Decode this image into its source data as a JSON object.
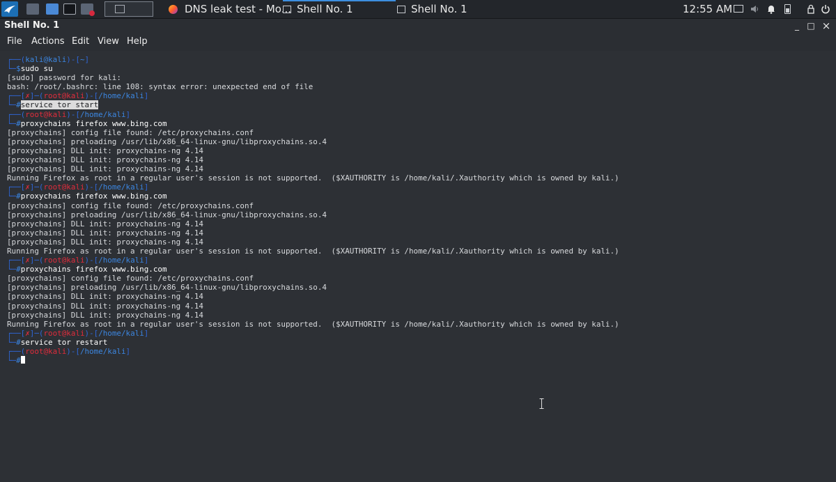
{
  "panel": {
    "clock": "12:55 AM",
    "tasks": [
      {
        "label": "DNS leak test - Mo..."
      },
      {
        "label": "Shell No. 1"
      },
      {
        "label": "Shell No. 1"
      }
    ],
    "accent_color": "#3d8fe0"
  },
  "window": {
    "title": "Shell No. 1",
    "buttons": {
      "minimize": "_",
      "maximize": "□",
      "close": "×"
    }
  },
  "menu": {
    "file": "File",
    "actions": "Actions",
    "edit": "Edit",
    "view": "View",
    "help": "Help"
  },
  "terminal": {
    "colors": {
      "bracket": "#2e67d8",
      "root": "#e12c3c",
      "user": "#3c86e0",
      "text": "#d8dadd"
    },
    "lines": [
      {
        "kind": "prompt-top",
        "user": "kali",
        "host": "kali",
        "dir": "~",
        "err": false,
        "userColor": "usr"
      },
      {
        "kind": "prompt-cmd",
        "sym": "$",
        "cmd": "sudo su",
        "hl": false
      },
      {
        "kind": "out",
        "text": "[sudo] password for kali:"
      },
      {
        "kind": "out",
        "text": "bash: /root/.bashrc: line 108: syntax error: unexpected end of file"
      },
      {
        "kind": "prompt-top",
        "user": "root",
        "host": "kali",
        "dir": "/home/kali",
        "err": true,
        "userColor": "red"
      },
      {
        "kind": "prompt-cmd",
        "sym": "#",
        "cmd": "service tor start",
        "hl": true
      },
      {
        "kind": "prompt-top",
        "user": "root",
        "host": "kali",
        "dir": "/home/kali",
        "err": false,
        "userColor": "red"
      },
      {
        "kind": "prompt-cmd",
        "sym": "#",
        "cmd": "proxychains firefox www.bing.com",
        "hl": false
      },
      {
        "kind": "out",
        "text": "[proxychains] config file found: /etc/proxychains.conf"
      },
      {
        "kind": "out",
        "text": "[proxychains] preloading /usr/lib/x86_64-linux-gnu/libproxychains.so.4"
      },
      {
        "kind": "out",
        "text": "[proxychains] DLL init: proxychains-ng 4.14"
      },
      {
        "kind": "out",
        "text": "[proxychains] DLL init: proxychains-ng 4.14"
      },
      {
        "kind": "out",
        "text": "[proxychains] DLL init: proxychains-ng 4.14"
      },
      {
        "kind": "out",
        "text": "Running Firefox as root in a regular user's session is not supported.  ($XAUTHORITY is /home/kali/.Xauthority which is owned by kali.)"
      },
      {
        "kind": "prompt-top",
        "user": "root",
        "host": "kali",
        "dir": "/home/kali",
        "err": true,
        "userColor": "red"
      },
      {
        "kind": "prompt-cmd",
        "sym": "#",
        "cmd": "proxychains firefox www.bing.com",
        "hl": false
      },
      {
        "kind": "out",
        "text": "[proxychains] config file found: /etc/proxychains.conf"
      },
      {
        "kind": "out",
        "text": "[proxychains] preloading /usr/lib/x86_64-linux-gnu/libproxychains.so.4"
      },
      {
        "kind": "out",
        "text": "[proxychains] DLL init: proxychains-ng 4.14"
      },
      {
        "kind": "out",
        "text": "[proxychains] DLL init: proxychains-ng 4.14"
      },
      {
        "kind": "out",
        "text": "[proxychains] DLL init: proxychains-ng 4.14"
      },
      {
        "kind": "out",
        "text": "Running Firefox as root in a regular user's session is not supported.  ($XAUTHORITY is /home/kali/.Xauthority which is owned by kali.)"
      },
      {
        "kind": "prompt-top",
        "user": "root",
        "host": "kali",
        "dir": "/home/kali",
        "err": true,
        "userColor": "red"
      },
      {
        "kind": "prompt-cmd",
        "sym": "#",
        "cmd": "proxychains firefox www.bing.com",
        "hl": false
      },
      {
        "kind": "out",
        "text": "[proxychains] config file found: /etc/proxychains.conf"
      },
      {
        "kind": "out",
        "text": "[proxychains] preloading /usr/lib/x86_64-linux-gnu/libproxychains.so.4"
      },
      {
        "kind": "out",
        "text": "[proxychains] DLL init: proxychains-ng 4.14"
      },
      {
        "kind": "out",
        "text": "[proxychains] DLL init: proxychains-ng 4.14"
      },
      {
        "kind": "out",
        "text": "[proxychains] DLL init: proxychains-ng 4.14"
      },
      {
        "kind": "out",
        "text": "Running Firefox as root in a regular user's session is not supported.  ($XAUTHORITY is /home/kali/.Xauthority which is owned by kali.)"
      },
      {
        "kind": "prompt-top",
        "user": "root",
        "host": "kali",
        "dir": "/home/kali",
        "err": true,
        "userColor": "red"
      },
      {
        "kind": "prompt-cmd",
        "sym": "#",
        "cmd": "service tor restart",
        "hl": false
      },
      {
        "kind": "prompt-top",
        "user": "root",
        "host": "kali",
        "dir": "/home/kali",
        "err": false,
        "userColor": "red"
      },
      {
        "kind": "prompt-cmd",
        "sym": "#",
        "cmd": "",
        "hl": false,
        "cursor": true
      }
    ]
  }
}
